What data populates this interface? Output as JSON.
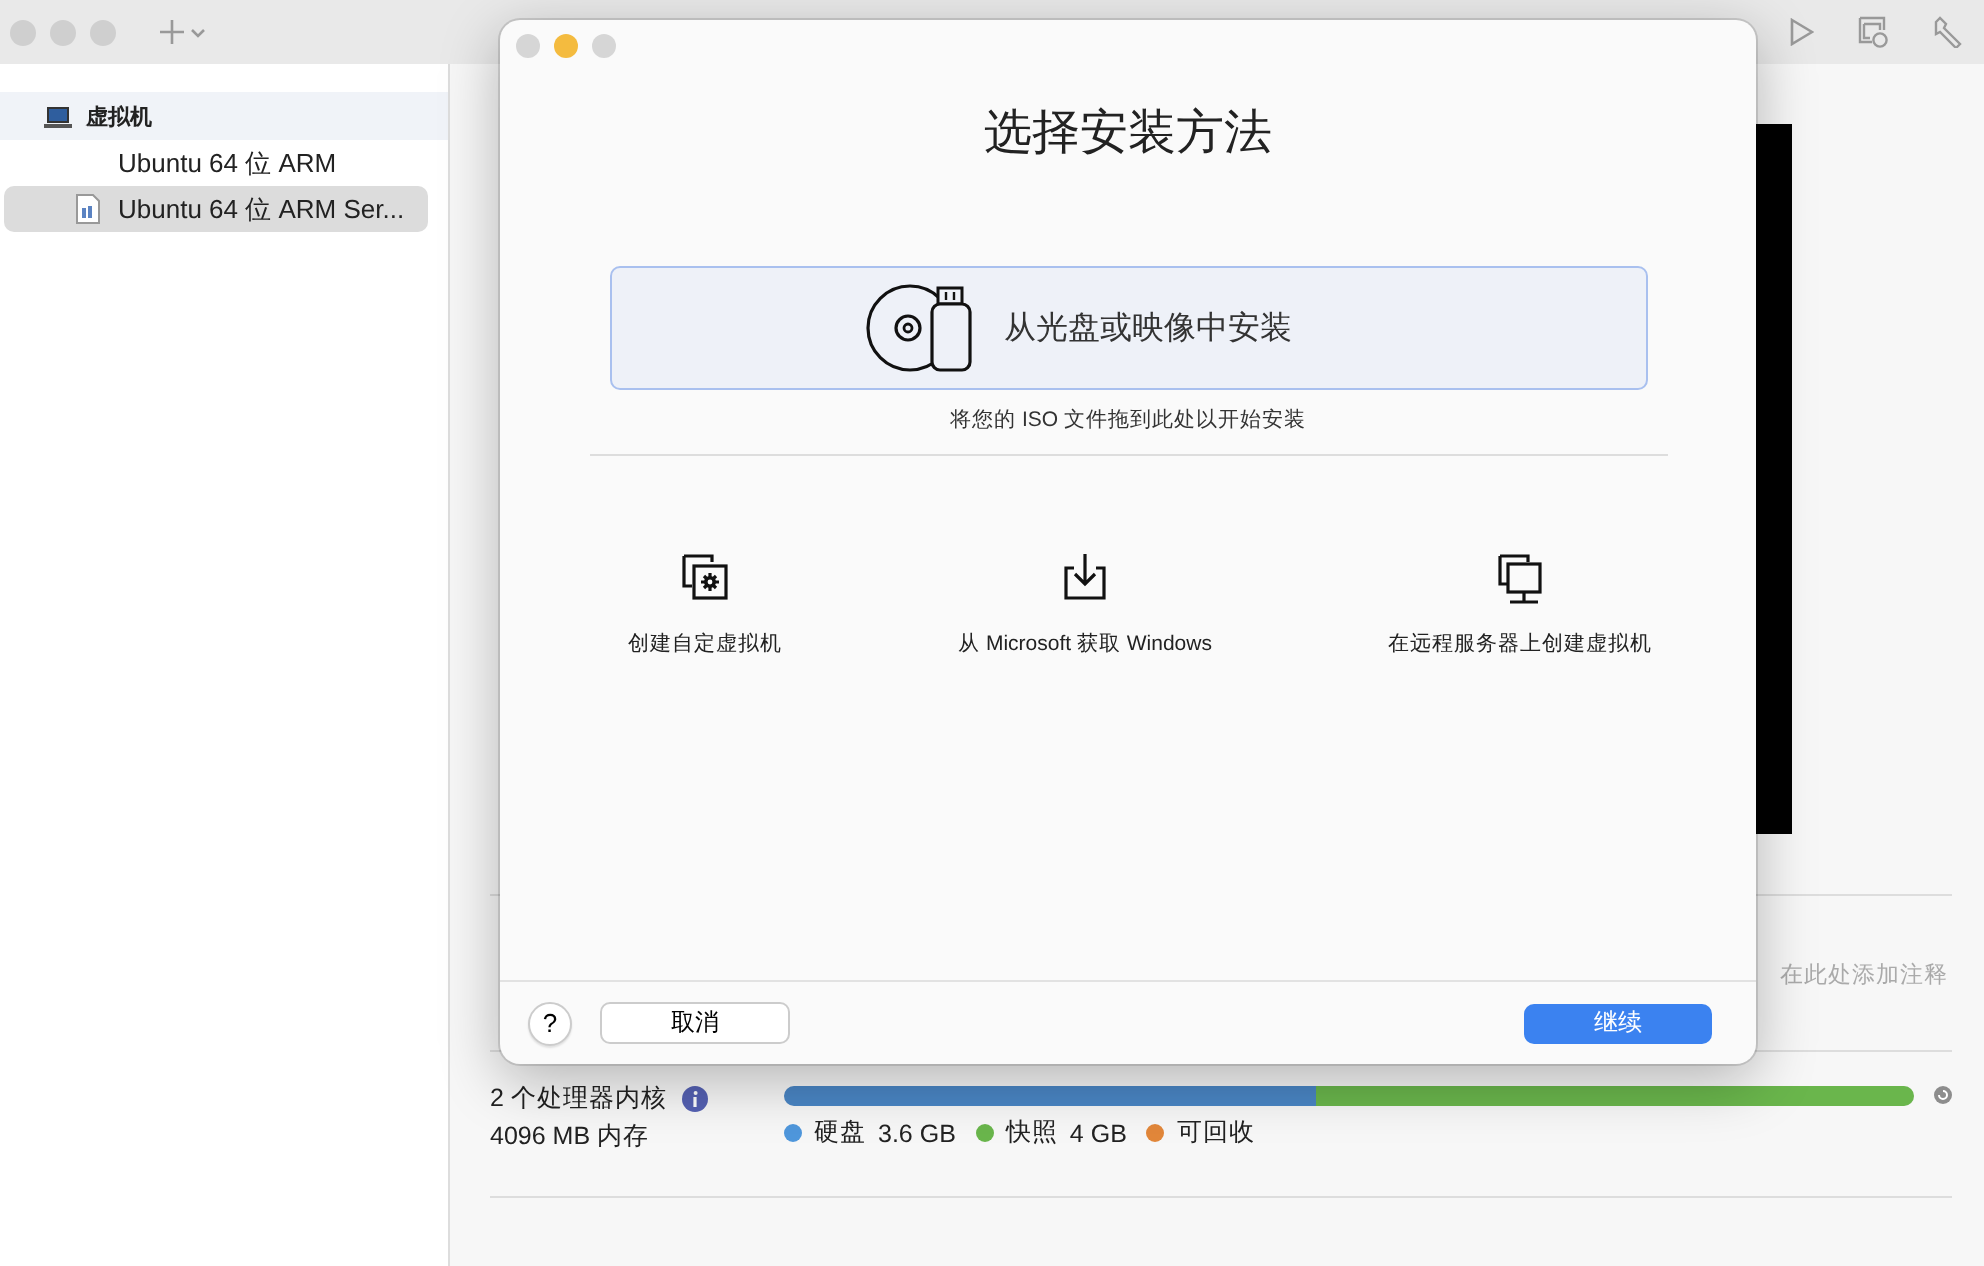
{
  "sidebar": {
    "section": "虚拟机",
    "items": [
      {
        "label": "Ubuntu 64 位 ARM",
        "kind": "plain",
        "selected": false
      },
      {
        "label": "Ubuntu 64 位 ARM Ser...",
        "kind": "document",
        "selected": true
      }
    ]
  },
  "notes": {
    "placeholder": "在此处添加注释"
  },
  "stats": {
    "processors": "2 个处理器内核",
    "memory": "4096 MB 内存",
    "bar": [
      {
        "color": "#4a86c5",
        "level": 0.47
      },
      {
        "color": "#6ab64c",
        "level": 0.53
      }
    ],
    "legend": [
      {
        "label": "硬盘",
        "value": "3.6 GB",
        "color": "#4f97dc"
      },
      {
        "label": "快照",
        "value": "4 GB",
        "color": "#6ab64c"
      },
      {
        "label": "可回收",
        "color": "#e2873a"
      }
    ]
  },
  "dialog": {
    "title": "选择安装方法",
    "install": {
      "label": "从光盘或映像中安装",
      "hint": "将您的 ISO 文件拖到此处以开始安装"
    },
    "options": [
      {
        "kind": "custom",
        "label": "创建自定虚拟机"
      },
      {
        "kind": "download",
        "label": "从 Microsoft 获取 Windows"
      },
      {
        "kind": "remote",
        "label": "在远程服务器上创建虚拟机"
      }
    ],
    "help": "?",
    "cancel": "取消",
    "continue": "继续"
  }
}
